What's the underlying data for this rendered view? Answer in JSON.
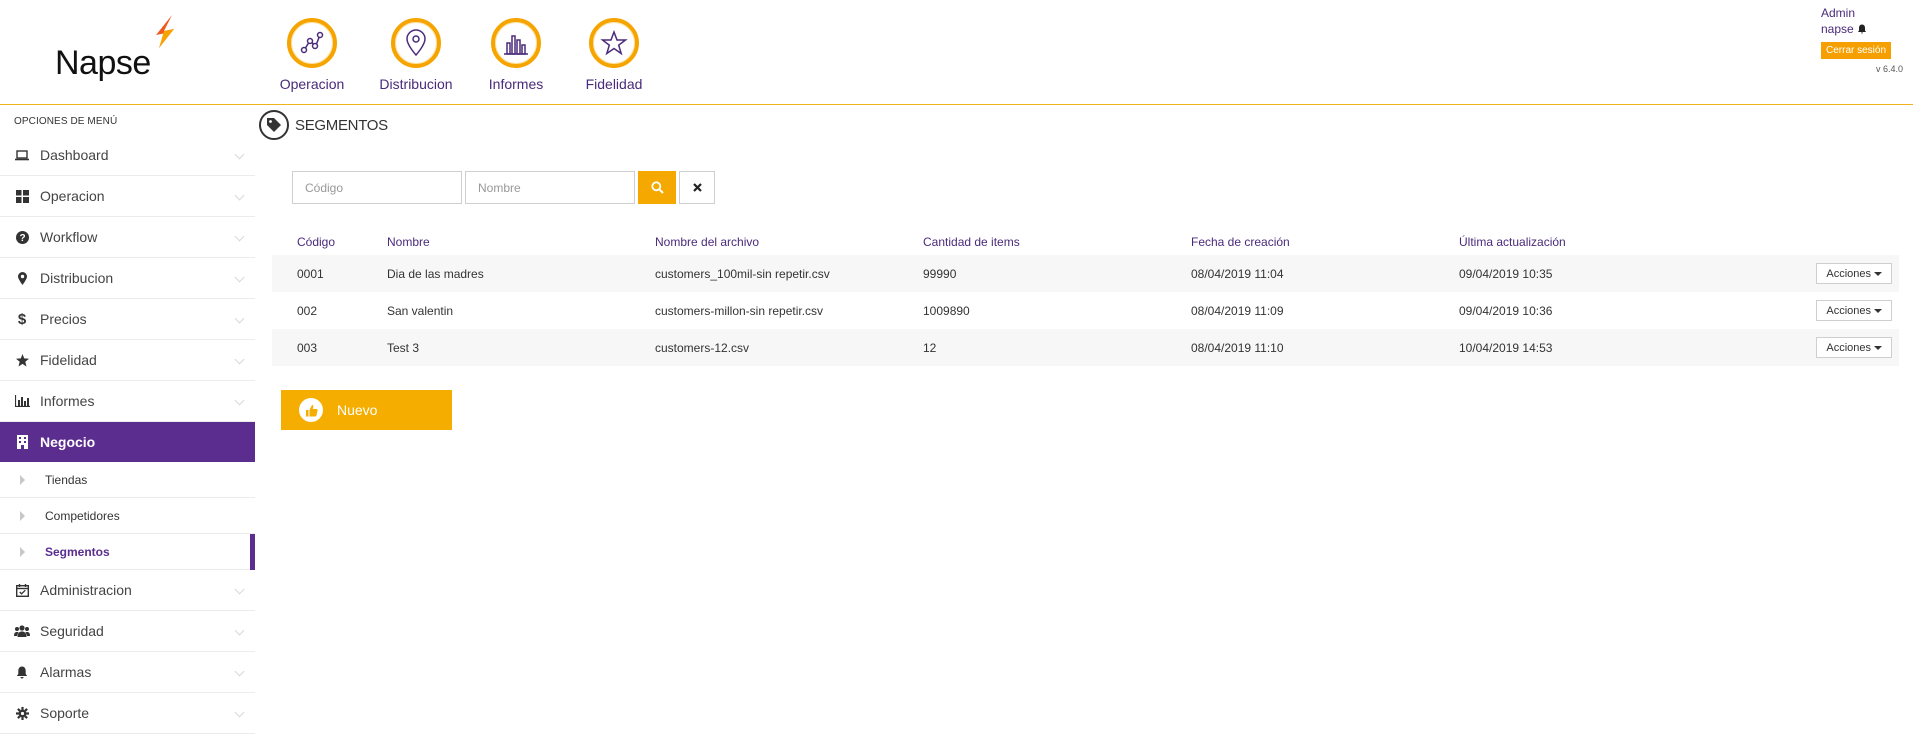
{
  "brand": {
    "logo_text": "Napse",
    "accent": "#f5a400",
    "primary": "#5b2d8e"
  },
  "topnav": [
    {
      "label": "Operacion",
      "icon": "graph-nodes-icon"
    },
    {
      "label": "Distribucion",
      "icon": "map-pin-icon"
    },
    {
      "label": "Informes",
      "icon": "bar-chart-icon"
    },
    {
      "label": "Fidelidad",
      "icon": "star-icon"
    }
  ],
  "user": {
    "role": "Admin",
    "name": "napse",
    "logout_label": "Cerrar sesión",
    "version": "v 6.4.0"
  },
  "sidebar": {
    "title": "OPCIONES DE MENÚ",
    "items": [
      {
        "label": "Dashboard",
        "icon": "laptop-icon"
      },
      {
        "label": "Operacion",
        "icon": "grid-icon"
      },
      {
        "label": "Workflow",
        "icon": "question-circle-icon"
      },
      {
        "label": "Distribucion",
        "icon": "map-marker-icon"
      },
      {
        "label": "Precios",
        "icon": "dollar-icon"
      },
      {
        "label": "Fidelidad",
        "icon": "star-icon"
      },
      {
        "label": "Informes",
        "icon": "bar-chart-icon"
      },
      {
        "label": "Negocio",
        "icon": "building-icon",
        "active": true
      },
      {
        "label": "Administracion",
        "icon": "calendar-check-icon"
      },
      {
        "label": "Seguridad",
        "icon": "users-icon"
      },
      {
        "label": "Alarmas",
        "icon": "bell-icon"
      },
      {
        "label": "Soporte",
        "icon": "cog-icon"
      }
    ],
    "subitems": [
      {
        "label": "Tiendas"
      },
      {
        "label": "Competidores"
      },
      {
        "label": "Segmentos",
        "current": true
      }
    ]
  },
  "page": {
    "title": "SEGMENTOS"
  },
  "filters": {
    "code_placeholder": "Código",
    "name_placeholder": "Nombre"
  },
  "table": {
    "headers": [
      "Código",
      "Nombre",
      "Nombre del archivo",
      "Cantidad de items",
      "Fecha de creación",
      "Última actualización"
    ],
    "rows": [
      [
        "0001",
        "Dia de las madres",
        "customers_100mil-sin repetir.csv",
        "99990",
        "08/04/2019 11:04",
        "09/04/2019 10:35"
      ],
      [
        "002",
        "San valentin",
        "customers-millon-sin repetir.csv",
        "1009890",
        "08/04/2019 11:09",
        "09/04/2019 10:36"
      ],
      [
        "003",
        "Test 3",
        "customers-12.csv",
        "12",
        "08/04/2019 11:10",
        "10/04/2019 14:53"
      ]
    ],
    "actions_label": "Acciones"
  },
  "new_button": {
    "label": "Nuevo"
  }
}
